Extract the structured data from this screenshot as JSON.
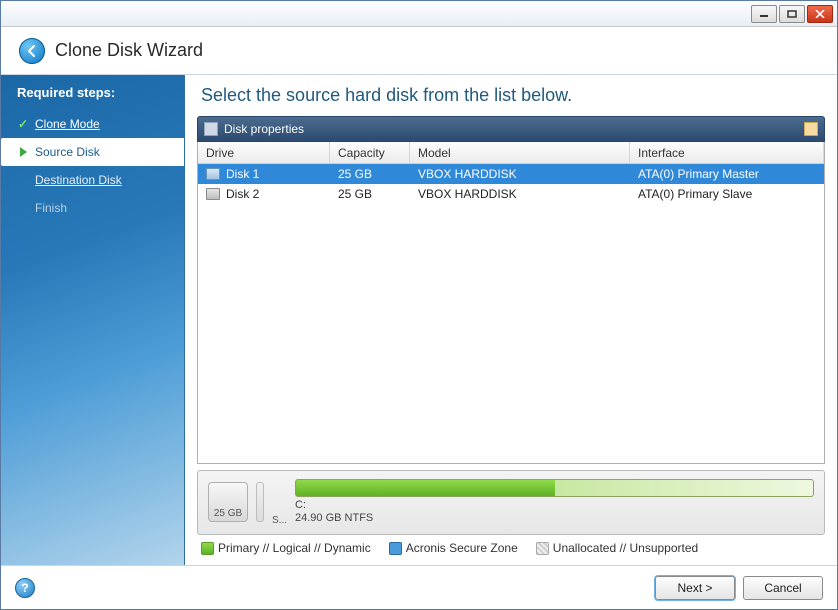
{
  "window": {
    "title": "Clone Disk Wizard"
  },
  "sidebar": {
    "header": "Required steps:",
    "steps": [
      {
        "label": "Clone Mode",
        "status": "done"
      },
      {
        "label": "Source Disk",
        "status": "active"
      },
      {
        "label": "Destination Disk",
        "status": "pending"
      },
      {
        "label": "Finish",
        "status": "disabled"
      }
    ]
  },
  "main": {
    "instruction": "Select the source hard disk from the list below.",
    "panel_title": "Disk properties",
    "columns": {
      "drive": "Drive",
      "capacity": "Capacity",
      "model": "Model",
      "interface": "Interface"
    },
    "rows": [
      {
        "drive": "Disk 1",
        "capacity": "25 GB",
        "model": "VBOX HARDDISK",
        "interface": "ATA(0) Primary Master",
        "selected": true
      },
      {
        "drive": "Disk 2",
        "capacity": "25 GB",
        "model": "VBOX HARDDISK",
        "interface": "ATA(0) Primary Slave",
        "selected": false
      }
    ]
  },
  "partition": {
    "disk_size_label": "25 GB",
    "small_letter": "S...",
    "volume_letter": "C:",
    "volume_detail": "24.90 GB  NTFS",
    "fill_pct": 50
  },
  "legend": {
    "primary": "Primary // Logical // Dynamic",
    "secure": "Acronis Secure Zone",
    "unalloc": "Unallocated // Unsupported"
  },
  "footer": {
    "next": "Next >",
    "cancel": "Cancel"
  }
}
